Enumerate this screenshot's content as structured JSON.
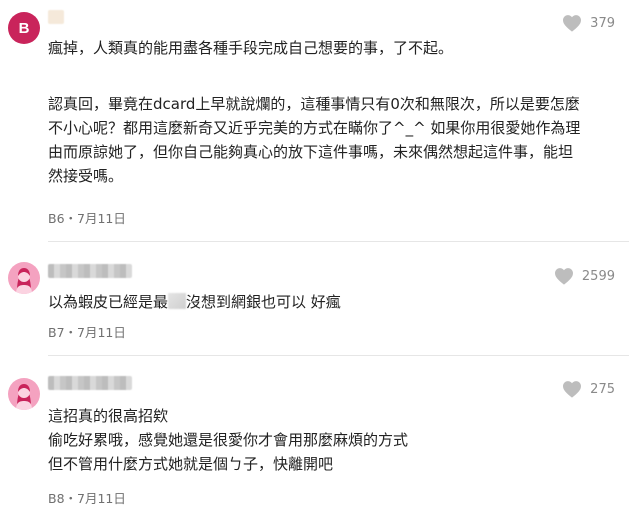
{
  "comments": [
    {
      "avatar_letter": "B",
      "likes": "379",
      "lines_a": [
        "瘋掉，人類真的能用盡各種手段完成自己想要的事，了不起。"
      ],
      "lines_b": [
        "認真回，畢竟在dcard上早就說爛的，這種事情只有0次和無限次，所以是要怎麼",
        "不小心呢？都用這麼新奇又近乎完美的方式在瞞你了^_^ 如果你用很愛她作為理",
        "由而原諒她了，但你自己能夠真心的放下這件事嗎，未來偶然想起這件事，能坦",
        "然接受嗎。"
      ],
      "meta": "B6・7月11日"
    },
    {
      "likes": "2599",
      "text_before": "以為蝦皮已經是最",
      "text_after": "沒想到網銀也可以 好瘋",
      "meta": "B7・7月11日"
    },
    {
      "likes": "275",
      "lines": [
        "這招真的很高招欸",
        "偷吃好累哦，感覺她還是很愛你才會用那麼麻煩的方式",
        "但不管用什麼方式她就是個ㄅ子，快離開吧"
      ],
      "meta": "B8・7月11日"
    }
  ],
  "colors": {
    "avatar_letter_bg": "#c9245b",
    "avatar_female_bg": "#f4a2c0",
    "heart": "#bdbdbd"
  }
}
